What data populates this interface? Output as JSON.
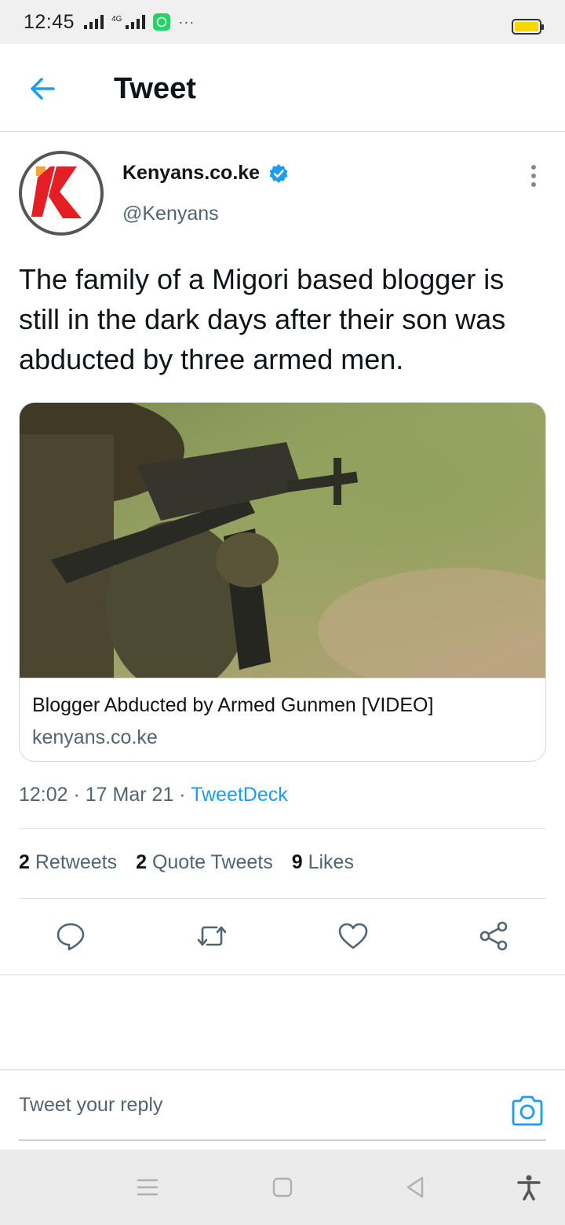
{
  "status_bar": {
    "time": "12:45",
    "network_label": "4G",
    "more": "···",
    "battery_color": "#f5d800"
  },
  "header": {
    "title": "Tweet",
    "back_icon": "arrow-left-icon"
  },
  "tweet": {
    "author_name": "Kenyans.co.ke",
    "author_handle": "@Kenyans",
    "verified_icon": "verified-badge-icon",
    "text": "The family of a Migori based blogger is still in the dark days after their son was abducted by three armed men.",
    "card": {
      "title": "Blogger Abducted by Armed Gunmen [VIDEO]",
      "domain": "kenyans.co.ke"
    },
    "time": "12:02",
    "date": "17 Mar 21",
    "source": "TweetDeck",
    "separator": " · "
  },
  "stats": {
    "retweets_count": "2",
    "retweets_label": "Retweets",
    "quotes_count": "2",
    "quotes_label": "Quote Tweets",
    "likes_count": "9",
    "likes_label": "Likes"
  },
  "actions": [
    "reply-icon",
    "retweet-icon",
    "like-icon",
    "share-icon"
  ],
  "reply": {
    "placeholder": "Tweet your reply"
  },
  "colors": {
    "accent": "#1d9bf0",
    "secondary_text": "#536471",
    "brand_red": "#e31e24"
  }
}
